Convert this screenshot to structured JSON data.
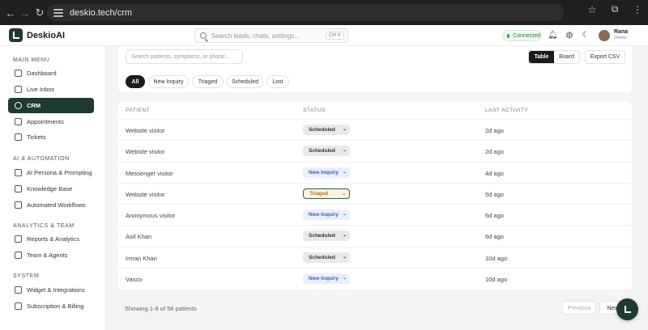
{
  "browser": {
    "url": "deskio.tech/crm",
    "icons": [
      "back-icon",
      "forward-icon",
      "reload-icon",
      "site-settings-icon",
      "star-icon",
      "extensions-icon",
      "kebab-menu-icon"
    ]
  },
  "header": {
    "app_name": "DeskioAI",
    "search_placeholder": "Search leads, chats, settings...",
    "search_shortcut": "Ctrl K",
    "connection_status": "Connected",
    "user_name": "Rana",
    "user_role": "Owner"
  },
  "sidebar": {
    "sections": [
      {
        "title": "MAIN MENU",
        "items": [
          {
            "label": "Dashboard",
            "icon": "grid-icon"
          },
          {
            "label": "Live Inbox",
            "icon": "inbox-icon"
          },
          {
            "label": "CRM",
            "icon": "users-icon",
            "active": true
          },
          {
            "label": "Appointments",
            "icon": "calendar-icon"
          },
          {
            "label": "Tickets",
            "icon": "ticket-icon"
          }
        ]
      },
      {
        "title": "AI & AUTOMATION",
        "items": [
          {
            "label": "AI Persona & Prompting",
            "icon": "sparkle-icon"
          },
          {
            "label": "Knowledge Base",
            "icon": "book-icon"
          },
          {
            "label": "Automated Workflows",
            "icon": "workflow-icon"
          }
        ]
      },
      {
        "title": "ANALYTICS & TEAM",
        "items": [
          {
            "label": "Reports & Analytics",
            "icon": "chart-icon"
          },
          {
            "label": "Team & Agents",
            "icon": "team-icon"
          }
        ]
      },
      {
        "title": "SYSTEM",
        "items": [
          {
            "label": "Widget & Integrations",
            "icon": "monitor-icon"
          },
          {
            "label": "Subscription & Billing",
            "icon": "card-icon"
          }
        ]
      }
    ]
  },
  "toolbar": {
    "search_placeholder": "Search patients, symptoms, or phone...",
    "view_table": "Table",
    "view_board": "Board",
    "export_label": "Export CSV"
  },
  "filters": [
    "All",
    "New Inquiry",
    "Triaged",
    "Scheduled",
    "Lost"
  ],
  "table": {
    "headers": [
      "PATIENT",
      "STATUS",
      "LAST ACTIVITY"
    ],
    "rows": [
      {
        "patient": "Website visitor",
        "status": "Scheduled",
        "activity": "2d ago"
      },
      {
        "patient": "Website visitor",
        "status": "Scheduled",
        "activity": "2d ago"
      },
      {
        "patient": "Messenger visitor",
        "status": "New Inquiry",
        "activity": "4d ago"
      },
      {
        "patient": "Website visitor",
        "status": "Triaged",
        "activity": "5d ago"
      },
      {
        "patient": "Anonymous visitor",
        "status": "New Inquiry",
        "activity": "6d ago"
      },
      {
        "patient": "Asif Khan",
        "status": "Scheduled",
        "activity": "6d ago"
      },
      {
        "patient": "Imran Khan",
        "status": "Scheduled",
        "activity": "10d ago"
      },
      {
        "patient": "Vasco",
        "status": "New Inquiry",
        "activity": "10d ago"
      }
    ]
  },
  "pagination": {
    "summary": "Showing 1-8 of 58 patients",
    "previous": "Previous",
    "next": "Next"
  },
  "colors": {
    "brand": "#1f3a2e",
    "scheduled": "#e8eae8",
    "new_inquiry": "#3b5bbf",
    "triaged": "#b8721b"
  }
}
